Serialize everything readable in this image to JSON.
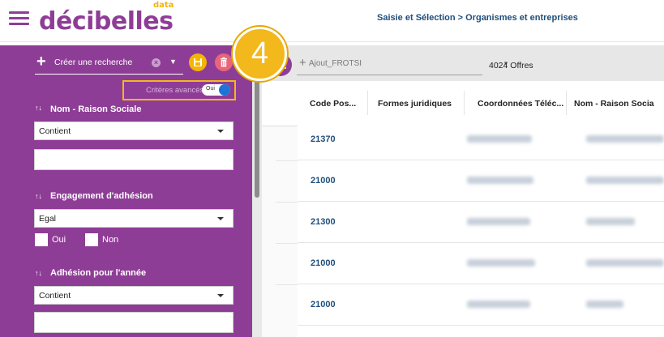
{
  "header": {
    "logo_text": "décibelles",
    "logo_superscript": "data",
    "breadcrumb": "Saisie et Sélection > Organismes et entreprises"
  },
  "sidebar": {
    "create_search_label": "Créer une recherche",
    "advanced_criteria_label": "Critères avancés",
    "advanced_toggle_value": "Oui",
    "step_badge": "4",
    "filters": [
      {
        "title": "Nom - Raison Sociale",
        "operator": "Contient",
        "value": ""
      },
      {
        "title": "Engagement d'adhésion",
        "operator": "Egal",
        "options": [
          "Oui",
          "Non"
        ]
      },
      {
        "title": "Adhésion pour l'année",
        "operator": "Contient",
        "value": ""
      }
    ]
  },
  "toolbar": {
    "ajout_placeholder": "Ajout_FROTSI",
    "offers_count": "4024 Offres"
  },
  "table": {
    "columns": [
      "Code Pos...",
      "Formes juridiques",
      "Coordonnées Téléc...",
      "Nom - Raison Socia"
    ],
    "rows": [
      {
        "code_postal": "21370"
      },
      {
        "code_postal": "21000"
      },
      {
        "code_postal": "21300"
      },
      {
        "code_postal": "21000"
      },
      {
        "code_postal": "21000"
      }
    ]
  },
  "colors": {
    "brand_purple": "#8e3d96",
    "accent_yellow": "#f2b81c",
    "delete_red": "#e8657a",
    "link_blue": "#1f4e79",
    "toggle_blue": "#1f73d6"
  },
  "icons": [
    "menu-icon",
    "plus-icon",
    "clear-icon",
    "dropdown-icon",
    "save-icon",
    "trash-icon",
    "sort-icon",
    "filter-settings-icon"
  ]
}
